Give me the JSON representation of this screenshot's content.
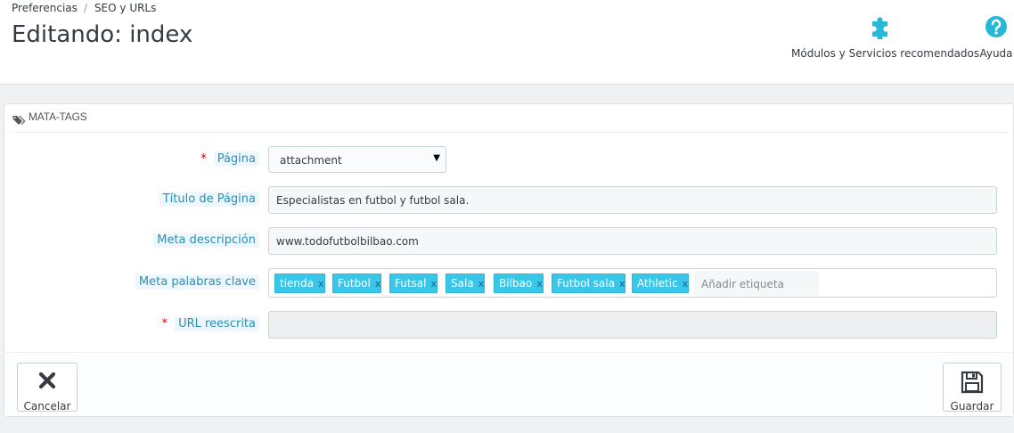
{
  "breadcrumb": {
    "parent": "Preferencias",
    "separator": "/",
    "current": "SEO y URLs"
  },
  "page": {
    "title": "Editando: index"
  },
  "toolbar": {
    "modules_label": "Módulos y Servicios recomendados",
    "help_label": "Ayuda"
  },
  "panel": {
    "heading": "MATA-TAGS",
    "page_field": {
      "label": "Página",
      "required_mark": "*",
      "value": "attachment",
      "caret": "▼"
    },
    "title_field": {
      "label": "Título de Página",
      "value": "Especialistas en futbol y futbol sala."
    },
    "description_field": {
      "label": "Meta descripción",
      "value": "www.todofutbolbilbao.com"
    },
    "keywords_field": {
      "label": "Meta palabras clave",
      "tags": [
        "tienda",
        "Futbol",
        "Futsal",
        "Sala",
        "Bilbao",
        "Futbol sala",
        "Athletic"
      ],
      "remove_glyph": "x",
      "add_placeholder": "Añadir etiqueta"
    },
    "url_field": {
      "label": "URL reescrita",
      "required_mark": "*",
      "value": ""
    }
  },
  "footer": {
    "cancel_label": "Cancelar",
    "save_label": "Guardar"
  },
  "colors": {
    "accent": "#25b9d7",
    "tag_bg": "#38c7e9",
    "required": "#cc0000"
  },
  "icons": {
    "modules": "puzzle-icon",
    "help": "question-circle-icon",
    "heading": "tags-icon",
    "cancel": "close-icon",
    "save": "floppy-disk-icon"
  }
}
